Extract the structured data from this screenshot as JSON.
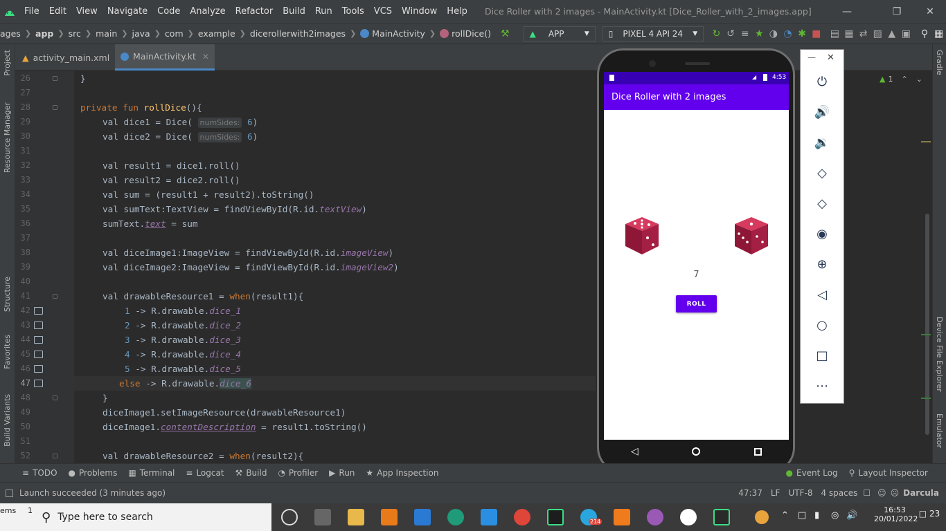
{
  "menubar": {
    "items": [
      "File",
      "Edit",
      "View",
      "Navigate",
      "Code",
      "Analyze",
      "Refactor",
      "Build",
      "Run",
      "Tools",
      "VCS",
      "Window",
      "Help"
    ],
    "title": "Dice Roller with 2 images - MainActivity.kt [Dice_Roller_with_2_images.app]"
  },
  "breadcrumb": {
    "items": [
      "ages",
      "app",
      "src",
      "main",
      "java",
      "com",
      "example",
      "dicerollerwith2images",
      "MainActivity",
      "rollDice()"
    ],
    "run_config": "APP",
    "device": "PIXEL 4 API 24"
  },
  "tabs": [
    {
      "label": "activity_main.xml"
    },
    {
      "label": "MainActivity.kt"
    }
  ],
  "left_panels": [
    "Project",
    "Resource Manager",
    "Structure",
    "Favorites",
    "Build Variants"
  ],
  "right_panels": [
    "Gradle",
    "Device File Explorer",
    "Emulator"
  ],
  "inspection": {
    "count": "1"
  },
  "editor": {
    "line_numbers": [
      "26",
      "27",
      "28",
      "29",
      "30",
      "31",
      "32",
      "33",
      "34",
      "35",
      "36",
      "37",
      "38",
      "39",
      "40",
      "41",
      "42",
      "43",
      "44",
      "45",
      "46",
      "47",
      "48",
      "49",
      "50",
      "51",
      "52"
    ],
    "current_line": "47",
    "hints": {
      "num_sides": "numSides:"
    },
    "code": {
      "l26": "}",
      "l28_kw": "private fun ",
      "l28_fn": "rollDice",
      "l28_rest": "(){",
      "l29_a": "val dice1 = Dice( ",
      "l29_n": "6",
      "l29_b": ")",
      "l30_a": "val dice2 = Dice( ",
      "l30_n": "6",
      "l30_b": ")",
      "l32": "val result1 = dice1.roll()",
      "l33": "val result2 = dice2.roll()",
      "l34": "val sum = (result1 + result2).toString()",
      "l35_a": "val sumText:TextView = findViewById(R.id.",
      "l35_i": "textView",
      "l35_b": ")",
      "l36_a": "sumText.",
      "l36_i": "text",
      "l36_b": " = sum",
      "l38_a": "val diceImage1:ImageView = findViewById(R.id.",
      "l38_i": "imageView",
      "l38_b": ")",
      "l39_a": "val diceImage2:ImageView = findViewById(R.id.",
      "l39_i": "imageView2",
      "l39_b": ")",
      "l41_a": "val drawableResource1 = ",
      "l41_kw": "when",
      "l41_b": "(result1){",
      "l42_n": "1",
      "l42_a": " -> R.drawable.",
      "l42_i": "dice_1",
      "l43_n": "2",
      "l43_a": " -> R.drawable.",
      "l43_i": "dice_2",
      "l44_n": "3",
      "l44_a": " -> R.drawable.",
      "l44_i": "dice_3",
      "l45_n": "4",
      "l45_a": " -> R.drawable.",
      "l45_i": "dice_4",
      "l46_n": "5",
      "l46_a": " -> R.drawable.",
      "l46_i": "dice_5",
      "l47_kw": "else",
      "l47_a": " -> R.drawable.",
      "l47_i": "dice_6",
      "l48": "}",
      "l49": "diceImage1.setImageResource(drawableResource1)",
      "l50_a": "diceImage1.",
      "l50_i": "contentDescription",
      "l50_b": " = result1.toString()",
      "l52_a": "val drawableResource2 = ",
      "l52_kw": "when",
      "l52_b": "(result2){"
    },
    "val_kw": "val"
  },
  "emulator": {
    "time": "4:53",
    "app_title": "Dice Roller with 2 images",
    "sum_text": "7",
    "roll_button": "ROLL"
  },
  "bottom_tools": [
    "TODO",
    "Problems",
    "Terminal",
    "Logcat",
    "Build",
    "Profiler",
    "Run",
    "App Inspection",
    "Event Log",
    "Layout Inspector"
  ],
  "statusbar": {
    "message": "Launch succeeded (3 minutes ago)",
    "position": "47:37",
    "line_sep": "LF",
    "encoding": "UTF-8",
    "indent": "4 spaces",
    "theme": "Darcula"
  },
  "taskbar": {
    "left_text": "ems",
    "left_num": "1",
    "search_placeholder": "Type here to search",
    "badge": "214",
    "clock_time": "16:53",
    "clock_date": "20/01/2022",
    "notif": "23"
  }
}
